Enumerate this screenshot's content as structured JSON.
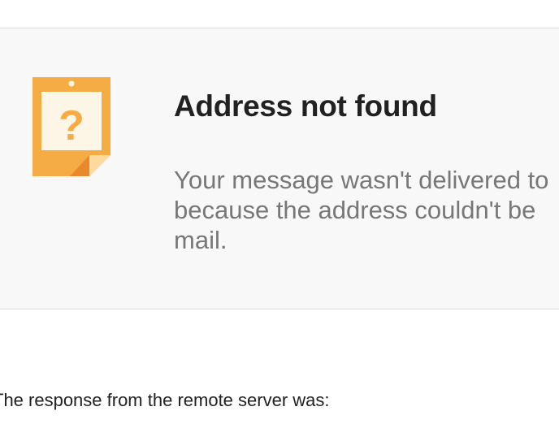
{
  "bounce": {
    "icon": "question-note-icon",
    "icon_glyph": "?",
    "title": "Address not found",
    "message": "Your message wasn't delivered to because the address couldn't be mail.",
    "message_lines": [
      "Your message wasn't delivered to",
      "because the address couldn't be",
      "mail."
    ],
    "response_intro": "The response from the remote server was:"
  },
  "colors": {
    "icon_orange": "#f5ac45",
    "icon_inner": "#fdf5e6",
    "icon_fold": "#e8892e",
    "title_text": "#212121",
    "message_text": "#777777",
    "banner_bg": "#f8f8f8"
  }
}
